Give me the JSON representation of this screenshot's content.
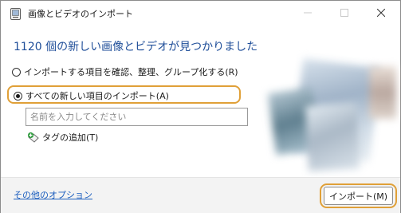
{
  "window": {
    "title": "画像とビデオのインポート",
    "icon": "photo-import-app-icon",
    "controls": {
      "minimize": "minimize-icon",
      "maximize": "maximize-icon",
      "close": "close-icon"
    }
  },
  "main": {
    "heading": "1120 個の新しい画像とビデオが見つかりました",
    "options": [
      {
        "label": "インポートする項目を確認、整理、グループ化する(R)",
        "selected": false
      },
      {
        "label": "すべての新しい項目のインポート(A)",
        "selected": true
      }
    ],
    "name_input": {
      "value": "",
      "placeholder": "名前を入力してください"
    },
    "add_tag": {
      "label": "タグの追加(T)",
      "icon": "tag-add-icon"
    }
  },
  "footer": {
    "more_options_link": "その他のオプション",
    "import_button": "インポート(M)"
  },
  "colors": {
    "heading": "#1f4e99",
    "link": "#1d5fbf",
    "highlight": "#e0a038",
    "footer_bg": "#f3f3f3"
  }
}
